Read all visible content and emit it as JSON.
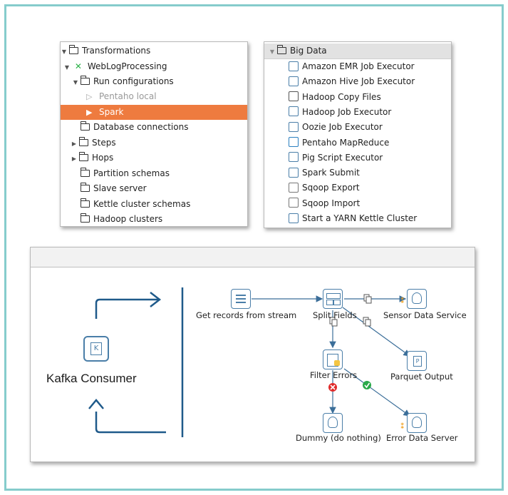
{
  "tree_panel": {
    "items": [
      {
        "label": "Transformations"
      },
      {
        "label": "WebLogProcessing"
      },
      {
        "label": "Run configurations"
      },
      {
        "label": "Pentaho local"
      },
      {
        "label": "Spark"
      },
      {
        "label": "Database connections"
      },
      {
        "label": "Steps"
      },
      {
        "label": "Hops"
      },
      {
        "label": "Partition schemas"
      },
      {
        "label": "Slave server"
      },
      {
        "label": "Kettle cluster schemas"
      },
      {
        "label": "Hadoop clusters"
      }
    ],
    "selected_color": "#ee7b3f"
  },
  "bigdata_panel": {
    "header": "Big Data",
    "items": [
      {
        "label": "Amazon EMR Job Executor",
        "icon": "emr-icon"
      },
      {
        "label": "Amazon Hive Job Executor",
        "icon": "hive-icon"
      },
      {
        "label": "Hadoop Copy Files",
        "icon": "copy-files-icon"
      },
      {
        "label": "Hadoop Job Executor",
        "icon": "hadoop-icon"
      },
      {
        "label": "Oozie Job Executor",
        "icon": "oozie-icon"
      },
      {
        "label": "Pentaho MapReduce",
        "icon": "mapreduce-icon"
      },
      {
        "label": "Pig Script Executor",
        "icon": "pig-icon"
      },
      {
        "label": "Spark Submit",
        "icon": "spark-icon"
      },
      {
        "label": "Sqoop Export",
        "icon": "sqoop-export-icon"
      },
      {
        "label": "Sqoop Import",
        "icon": "sqoop-import-icon"
      },
      {
        "label": "Start a YARN Kettle Cluster",
        "icon": "yarn-icon"
      }
    ]
  },
  "canvas": {
    "kafka_label": "Kafka Consumer",
    "steps": {
      "get_records": "Get records from stream",
      "split_fields": "Split Fields",
      "sensor_service": "Sensor Data Service",
      "parquet_output": "Parquet Output",
      "filter_errors": "Filter Errors",
      "dummy": "Dummy (do nothing)",
      "error_server": "Error Data Server"
    },
    "accent": "#1f5a8a"
  }
}
